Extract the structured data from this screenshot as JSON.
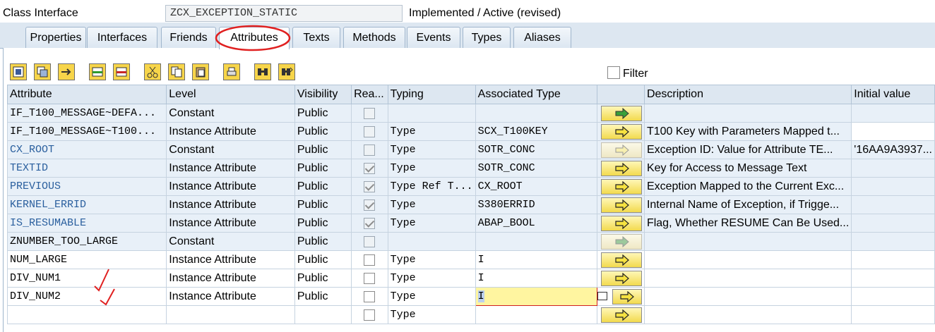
{
  "header": {
    "label": "Class Interface",
    "class_name": "ZCX_EXCEPTION_STATIC",
    "status": "Implemented / Active (revised)"
  },
  "tabs": [
    {
      "label": "Properties"
    },
    {
      "label": "Interfaces"
    },
    {
      "label": "Friends"
    },
    {
      "label": "Attributes",
      "active": true
    },
    {
      "label": "Texts"
    },
    {
      "label": "Methods"
    },
    {
      "label": "Events"
    },
    {
      "label": "Types"
    },
    {
      "label": "Aliases"
    }
  ],
  "toolbar": {
    "filter_label": "Filter",
    "filter_checked": false
  },
  "table": {
    "headers": [
      "Attribute",
      "Level",
      "Visibility",
      "Rea...",
      "Typing",
      "Associated Type",
      "",
      "Description",
      "Initial value"
    ],
    "rows": [
      {
        "attribute": "IF_T100_MESSAGE~DEFA...",
        "level": "Constant",
        "visibility": "Public",
        "read_only": false,
        "typing": "",
        "assoc_type": "",
        "description": "",
        "initial_value": ""
      },
      {
        "attribute": "IF_T100_MESSAGE~T100...",
        "level": "Instance Attribute",
        "visibility": "Public",
        "read_only": false,
        "typing": "Type",
        "assoc_type": "SCX_T100KEY",
        "description": "T100 Key with Parameters Mapped t...",
        "initial_value": ""
      },
      {
        "attribute": "CX_ROOT",
        "level": "Constant",
        "visibility": "Public",
        "read_only": false,
        "typing": "Type",
        "assoc_type": "SOTR_CONC",
        "description": "Exception ID: Value for Attribute TE...",
        "initial_value": "'16AA9A3937..."
      },
      {
        "attribute": "TEXTID",
        "level": "Instance Attribute",
        "visibility": "Public",
        "read_only": true,
        "typing": "Type",
        "assoc_type": "SOTR_CONC",
        "description": "Key for Access to Message Text",
        "initial_value": ""
      },
      {
        "attribute": "PREVIOUS",
        "level": "Instance Attribute",
        "visibility": "Public",
        "read_only": true,
        "typing": "Type Ref T...",
        "assoc_type": "CX_ROOT",
        "description": "Exception Mapped to the Current Exc...",
        "initial_value": ""
      },
      {
        "attribute": "KERNEL_ERRID",
        "level": "Instance Attribute",
        "visibility": "Public",
        "read_only": true,
        "typing": "Type",
        "assoc_type": "S380ERRID",
        "description": "Internal Name of Exception, if Trigge...",
        "initial_value": ""
      },
      {
        "attribute": "IS_RESUMABLE",
        "level": "Instance Attribute",
        "visibility": "Public",
        "read_only": true,
        "typing": "Type",
        "assoc_type": "ABAP_BOOL",
        "description": "Flag, Whether RESUME Can Be Used...",
        "initial_value": ""
      },
      {
        "attribute": "ZNUMBER_TOO_LARGE",
        "level": "Constant",
        "visibility": "Public",
        "read_only": false,
        "typing": "",
        "assoc_type": "",
        "description": "",
        "initial_value": ""
      },
      {
        "attribute": "NUM_LARGE",
        "level": "Instance Attribute",
        "visibility": "Public",
        "read_only": false,
        "typing": "Type",
        "assoc_type": "I",
        "description": "",
        "initial_value": ""
      },
      {
        "attribute": "DIV_NUM1",
        "level": "Instance Attribute",
        "visibility": "Public",
        "read_only": false,
        "typing": "Type",
        "assoc_type": "I",
        "description": "",
        "initial_value": ""
      },
      {
        "attribute": "DIV_NUM2",
        "level": "Instance Attribute",
        "visibility": "Public",
        "read_only": false,
        "typing": "Type",
        "assoc_type": "I",
        "description": "",
        "initial_value": ""
      },
      {
        "attribute": "",
        "level": "",
        "visibility": "",
        "read_only": false,
        "typing": "Type",
        "assoc_type": "",
        "description": "",
        "initial_value": ""
      }
    ]
  },
  "icons": {
    "goto_button": "yellow-arrow-right-icon",
    "value_help": "value-help-icon"
  }
}
